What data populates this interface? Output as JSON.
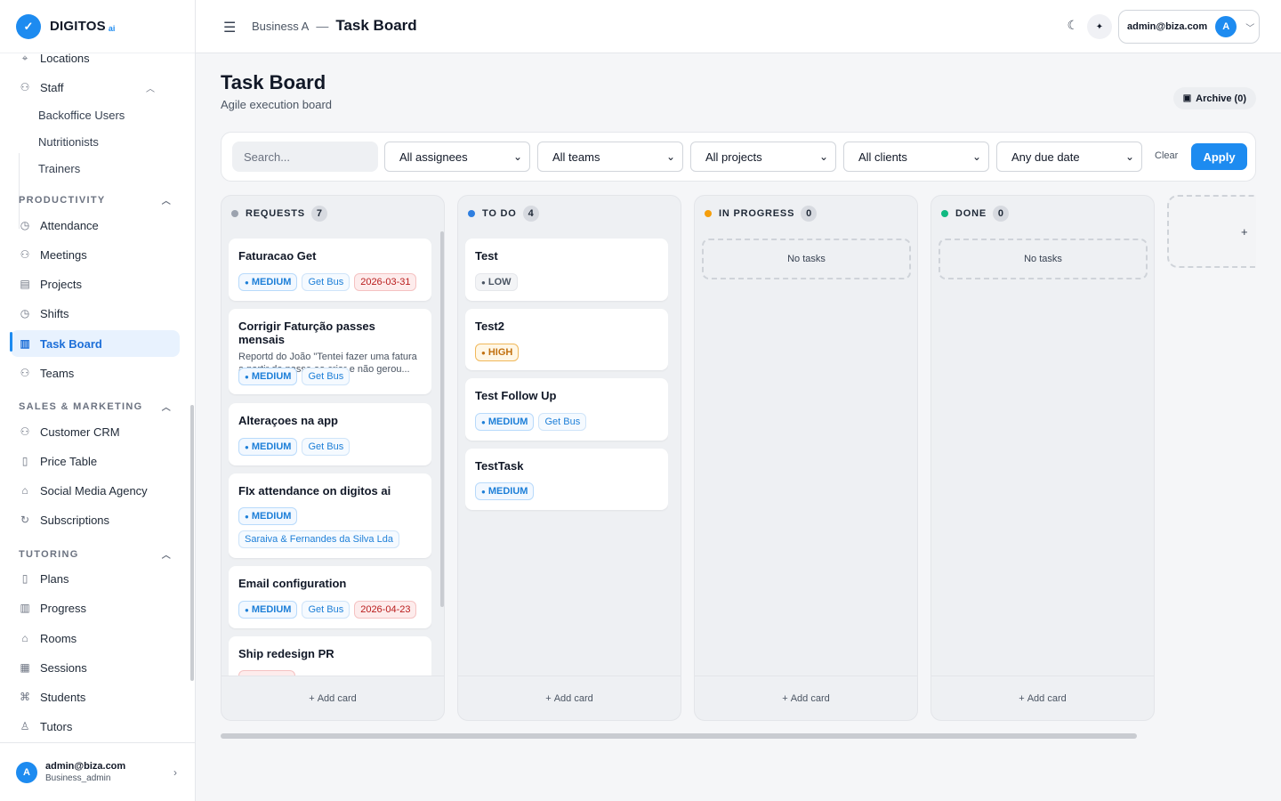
{
  "brand": {
    "name": "DIGITOS",
    "suffix": "ai"
  },
  "sidebar": {
    "items": [
      {
        "label": "Locations",
        "icon": "map-pin-icon"
      },
      {
        "label": "Staff",
        "icon": "staff-icon"
      },
      {
        "label": "Backoffice Users"
      },
      {
        "label": "Nutritionists"
      },
      {
        "label": "Trainers"
      },
      {
        "label": "Attendance",
        "icon": "clock-icon"
      },
      {
        "label": "Meetings",
        "icon": "meetings-icon"
      },
      {
        "label": "Projects",
        "icon": "projects-icon"
      },
      {
        "label": "Shifts",
        "icon": "shifts-icon"
      },
      {
        "label": "Task Board",
        "icon": "board-icon",
        "active": true
      },
      {
        "label": "Teams",
        "icon": "teams-icon"
      },
      {
        "label": "Customer CRM",
        "icon": "crm-icon"
      },
      {
        "label": "Price Table",
        "icon": "price-icon"
      },
      {
        "label": "Social Media Agency",
        "icon": "social-icon"
      },
      {
        "label": "Subscriptions",
        "icon": "refresh-icon"
      },
      {
        "label": "Plans",
        "icon": "plans-icon"
      },
      {
        "label": "Progress",
        "icon": "progress-icon"
      },
      {
        "label": "Rooms",
        "icon": "home-icon"
      },
      {
        "label": "Sessions",
        "icon": "calendar-icon"
      },
      {
        "label": "Students",
        "icon": "graduation-icon"
      },
      {
        "label": "Tutors",
        "icon": "user-icon"
      }
    ],
    "sections": {
      "productivity": "PRODUCTIVITY",
      "sales": "SALES & MARKETING",
      "tutoring": "TUTORING"
    },
    "user": {
      "email": "admin@biza.com",
      "role": "Business_admin",
      "initial": "A"
    }
  },
  "header": {
    "business": "Business A",
    "separator": "—",
    "title": "Task Board",
    "account_email": "admin@biza.com",
    "account_initial": "A"
  },
  "page": {
    "title": "Task Board",
    "subtitle": "Agile execution board",
    "archive_label": "Archive (0)"
  },
  "filters": {
    "search_placeholder": "Search...",
    "assignees": "All assignees",
    "teams": "All teams",
    "projects": "All projects",
    "clients": "All clients",
    "due": "Any due date",
    "clear": "Clear",
    "apply": "Apply"
  },
  "board": {
    "add_card": "Add card",
    "empty": "No tasks",
    "columns": [
      {
        "name": "REQUESTS",
        "count": "7",
        "color": "#9ca3af"
      },
      {
        "name": "TO DO",
        "count": "4",
        "color": "#2f7fe0"
      },
      {
        "name": "IN PROGRESS",
        "count": "0",
        "color": "#f59e0b"
      },
      {
        "name": "DONE",
        "count": "0",
        "color": "#10b981"
      }
    ],
    "requests": [
      {
        "title": "Faturacao Get",
        "priority": "MEDIUM",
        "client": "Get Bus",
        "due": "2026-03-31"
      },
      {
        "title": "Corrigir Faturção passes mensais",
        "desc": "Reportd do João \"Tentei fazer uma fatura a partir do passe ao criar e não gerou...",
        "priority": "MEDIUM",
        "client": "Get Bus"
      },
      {
        "title": "Alteraçoes na app",
        "priority": "MEDIUM",
        "client": "Get Bus"
      },
      {
        "title": "FIx attendance on digitos ai",
        "priority": "MEDIUM",
        "client": "Saraiva & Fernandes da Silva Lda"
      },
      {
        "title": "Email configuration",
        "priority": "MEDIUM",
        "client": "Get Bus",
        "due": "2026-04-23"
      },
      {
        "title": "Ship redesign PR"
      }
    ],
    "todo": [
      {
        "title": "Test",
        "priority": "LOW"
      },
      {
        "title": "Test2",
        "priority": "HIGH"
      },
      {
        "title": "Test Follow Up",
        "priority": "MEDIUM",
        "client": "Get Bus"
      },
      {
        "title": "TestTask",
        "priority": "MEDIUM"
      }
    ],
    "add_column": "+"
  }
}
